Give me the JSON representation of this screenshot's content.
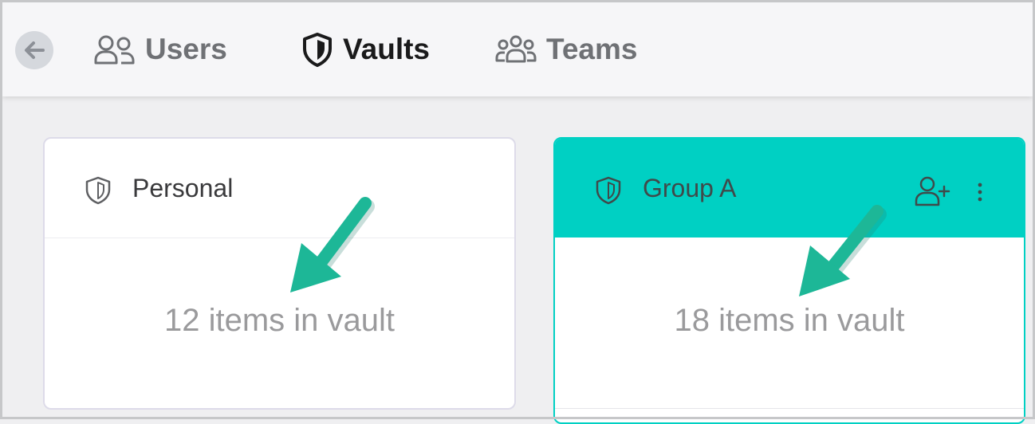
{
  "tabs": [
    {
      "label": "Users",
      "icon": "users-icon",
      "active": false
    },
    {
      "label": "Vaults",
      "icon": "shield-icon",
      "active": true
    },
    {
      "label": "Teams",
      "icon": "team-icon",
      "active": false
    }
  ],
  "colors": {
    "accent": "#b10fb4",
    "group_header": "#00d0c3",
    "arrow": "#1db797"
  },
  "vaults": [
    {
      "name": "Personal",
      "count_text": "12 items in vault"
    },
    {
      "name": "Group A",
      "count_text": "18 items in vault"
    }
  ]
}
